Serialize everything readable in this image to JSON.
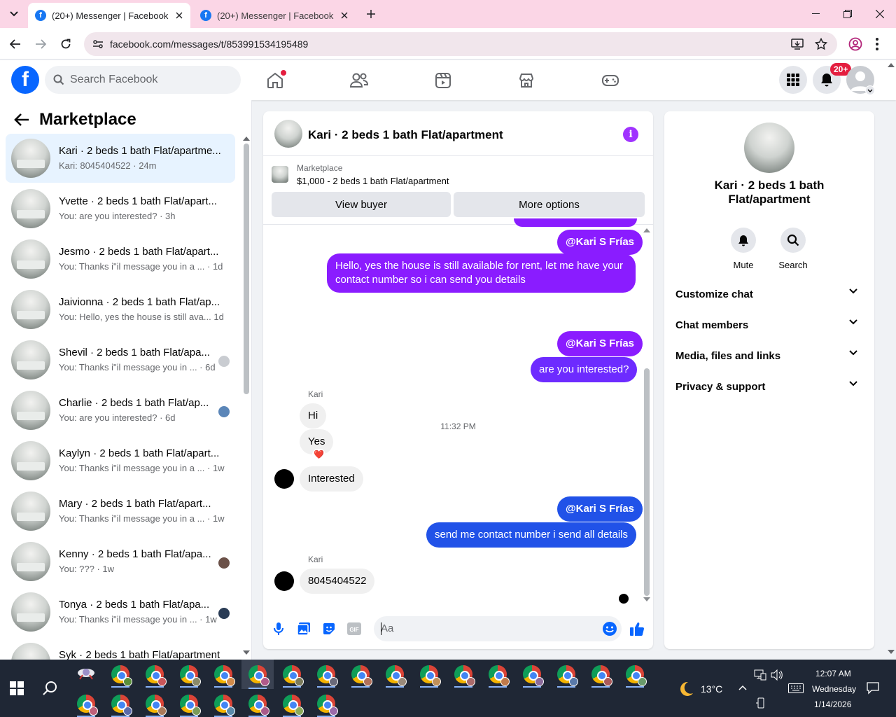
{
  "browser": {
    "tabs": [
      {
        "title": "(20+) Messenger | Facebook",
        "active": true
      },
      {
        "title": "(20+) Messenger | Facebook",
        "active": false
      }
    ],
    "url": "facebook.com/messages/t/853991534195489"
  },
  "fb_header": {
    "search_placeholder": "Search Facebook",
    "notification_badge": "20+",
    "nav_icons": [
      "home-icon",
      "friends-icon",
      "video-icon",
      "marketplace-icon",
      "gaming-icon"
    ]
  },
  "left": {
    "title": "Marketplace",
    "conversations": [
      {
        "name": "Kari · 2 beds 1 bath Flat/apartme...",
        "preview": "Kari: 8045404522 · 24m",
        "selected": true,
        "mini": ""
      },
      {
        "name": "Yvette · 2 beds 1 bath Flat/apart...",
        "preview": "You: are you interested? · 3h",
        "mini": ""
      },
      {
        "name": "Jesmo · 2 beds 1 bath Flat/apart...",
        "preview": "You: Thanks i\"il message you in a ...   · 1d",
        "mini": ""
      },
      {
        "name": "Jaivionna · 2 beds 1 bath Flat/ap...",
        "preview": "You: Hello, yes the house is still ava...  1d",
        "mini": ""
      },
      {
        "name": "Shevil · 2 beds 1 bath Flat/apa...",
        "preview": "You: Thanks i\"il message you in ... · 6d",
        "mini": "#c9ccd1"
      },
      {
        "name": "Charlie · 2 beds 1 bath Flat/ap...",
        "preview": "You: are you interested? · 6d",
        "mini": "#5b86b8"
      },
      {
        "name": "Kaylyn · 2 beds 1 bath Flat/apart...",
        "preview": "You: Thanks i\"il message you in a ...  · 1w",
        "mini": ""
      },
      {
        "name": "Mary · 2 beds 1 bath Flat/apart...",
        "preview": "You: Thanks i\"il message you in a ...  · 1w",
        "mini": ""
      },
      {
        "name": "Kenny · 2 beds 1 bath Flat/apa...",
        "preview": "You: ??? · 1w",
        "mini": "#6b5148"
      },
      {
        "name": "Tonya · 2 beds 1 bath Flat/apa...",
        "preview": "You: Thanks i\"il message you in ... · 1w",
        "mini": "#2a3c55"
      },
      {
        "name": "Syk · 2 beds 1 bath Flat/apartment",
        "preview": "",
        "mini": ""
      }
    ]
  },
  "chat": {
    "title": "Kari · 2 beds 1 bath Flat/apartment",
    "listing_label": "Marketplace",
    "listing_price": "$1,000 - 2 beds 1 bath Flat/apartment",
    "view_buyer": "View buyer",
    "more_options": "More options",
    "messages": {
      "mention1": "@Kari S Frías",
      "out1": "Hello, yes the house is still available for rent, let me have your contact number so i can send you details",
      "timestamp": "11:32 PM",
      "mention2": "@Kari S Frías",
      "out2": "are you interested?",
      "sender1": "Kari",
      "in1": "Hi",
      "in2": "Yes",
      "reaction": "❤️",
      "in3": "Interested",
      "mention3": "@Kari S Frías",
      "out3": "send me contact number i send all details",
      "sender2": "Kari",
      "in4": "8045404522"
    },
    "input_placeholder": "Aa"
  },
  "info": {
    "name": "Kari · 2 beds 1 bath Flat/apartment",
    "mute": "Mute",
    "search": "Search",
    "sections": [
      "Customize chat",
      "Chat members",
      "Media, files and links",
      "Privacy & support"
    ]
  },
  "taskbar": {
    "weather": "13°C",
    "time": "12:07 AM",
    "day": "Wednesday",
    "date": "1/14/2026"
  },
  "colors": {
    "accent_purple": "#8a1cff",
    "bubble_blue": "#2152e8",
    "facebook_blue": "#0866ff",
    "taskbar": "#1f2735"
  }
}
